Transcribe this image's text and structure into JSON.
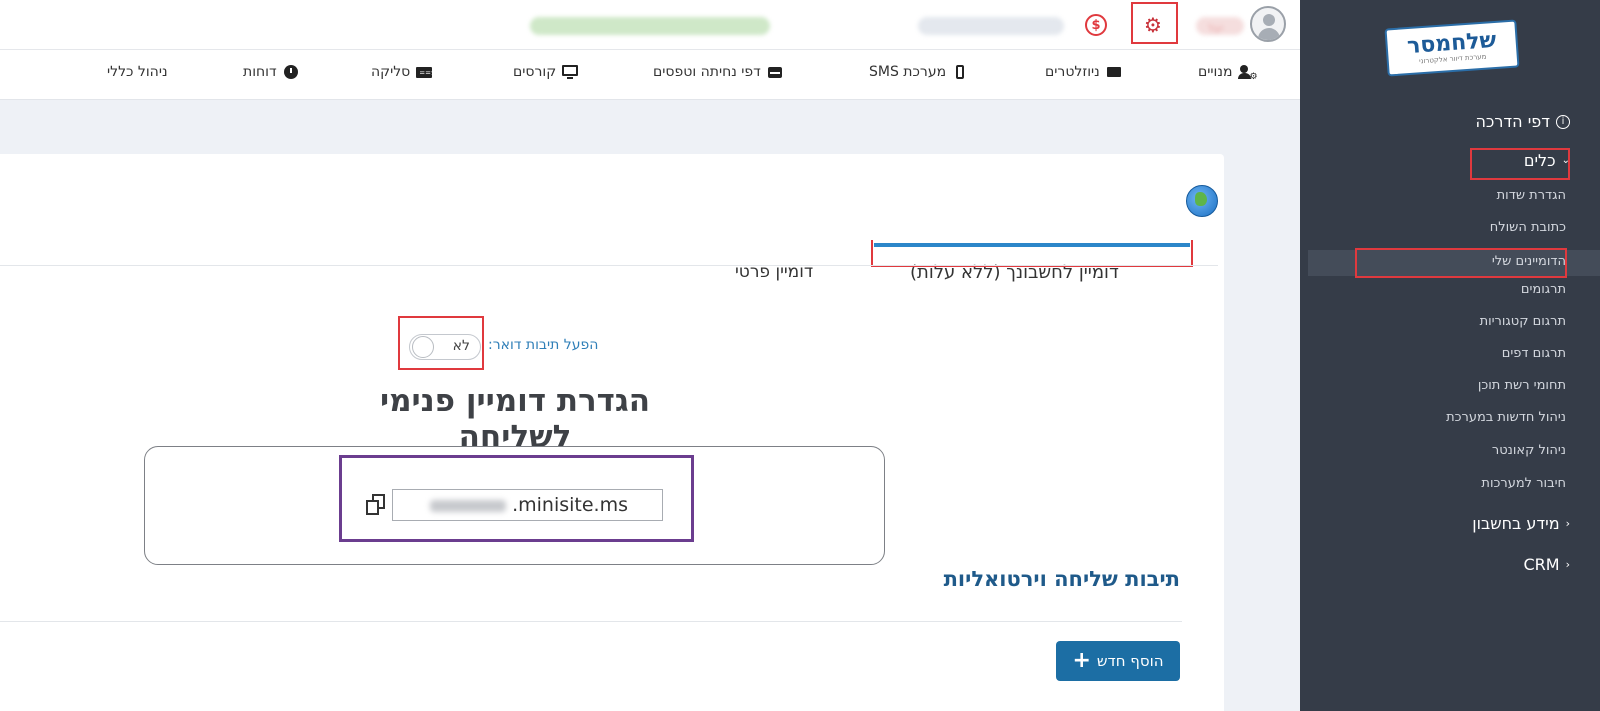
{
  "sidebar": {
    "logo_text": "שלחמסר",
    "logo_sub": "מערכת דיוור אלקטרוני",
    "guide_pages": "דפי הדרכה",
    "tools": "כלים",
    "tools_items": [
      "הגדרת שדות",
      "כתובת השולח",
      "הדומיינים שלי",
      "תרגומים",
      "תרגום קטגוריות",
      "תרגום דפים",
      "תחומי רשת תוכן",
      "ניהול חדשות במערכת",
      "ניהול קאונטר",
      "חיבור למערכות"
    ],
    "account_info": "מידע בחשבון",
    "crm": "CRM"
  },
  "topbar": {
    "user_name": "יעל"
  },
  "nav": {
    "items": [
      "מנויים",
      "ניוזלטרים",
      "מערכת SMS",
      "דפי נחיתה וטפסים",
      "קורסים",
      "סליקה",
      "דוחות",
      "ניהול כללי"
    ]
  },
  "tabs": {
    "account_domain": "דומיין לחשבונך (ללא עלות)",
    "private_domain": "דומיין פרטי"
  },
  "mailbox": {
    "label": "הפעל תיבות דואר:",
    "toggle_value": "לא"
  },
  "main": {
    "title": "הגדרת דומיין פנימי לשליחה",
    "url_suffix": ".minisite.ms",
    "section_title": "תיבות שליחה וירטואליות",
    "add_button": "הוסף חדש"
  },
  "colors": {
    "sidebar_bg": "#353c48",
    "accent_blue": "#1c6ea4",
    "highlight_red": "#e0393e",
    "highlight_purple": "#6b3d8f"
  }
}
